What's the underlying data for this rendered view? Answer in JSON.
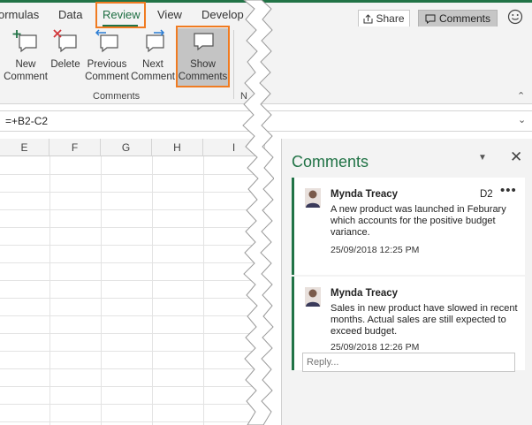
{
  "ribbon_tabs": [
    {
      "label": "ormulas",
      "active": false
    },
    {
      "label": "Data",
      "active": false
    },
    {
      "label": "Review",
      "active": true
    },
    {
      "label": "View",
      "active": false
    },
    {
      "label": "Develop",
      "active": false
    }
  ],
  "header": {
    "share_label": "Share",
    "comments_label": "Comments",
    "feedback_icon": "smiley-icon"
  },
  "ribbon": {
    "buttons": [
      {
        "label_line1": "New",
        "label_line2": "Comment",
        "icon": "new-comment-icon"
      },
      {
        "label_line1": "Delete",
        "label_line2": "",
        "icon": "delete-comment-icon"
      },
      {
        "label_line1": "Previous",
        "label_line2": "Comment",
        "icon": "previous-comment-icon"
      },
      {
        "label_line1": "Next",
        "label_line2": "Comment",
        "icon": "next-comment-icon"
      },
      {
        "label_line1": "Show",
        "label_line2": "Comments",
        "icon": "show-comments-icon"
      }
    ],
    "group_label": "Comments",
    "next_group_label": "N"
  },
  "formula_bar": {
    "formula": "=+B2-C2"
  },
  "grid": {
    "columns": [
      "E",
      "F",
      "G",
      "H",
      "I"
    ]
  },
  "comments_pane": {
    "title": "Comments",
    "comments": [
      {
        "author": "Mynda Treacy",
        "cell": "D2",
        "text": "A new product was launched in Feburary which accounts for the positive budget variance.",
        "timestamp": "25/09/2018 12:25 PM"
      },
      {
        "author": "Mynda Treacy",
        "cell": "",
        "text": "Sales in new product have slowed in recent months. Actual sales are still expected to exceed budget.",
        "timestamp": "25/09/2018 12:26 PM"
      }
    ],
    "reply_placeholder": "Reply..."
  },
  "colors": {
    "accent": "#217346",
    "highlight": "#f07b21"
  }
}
